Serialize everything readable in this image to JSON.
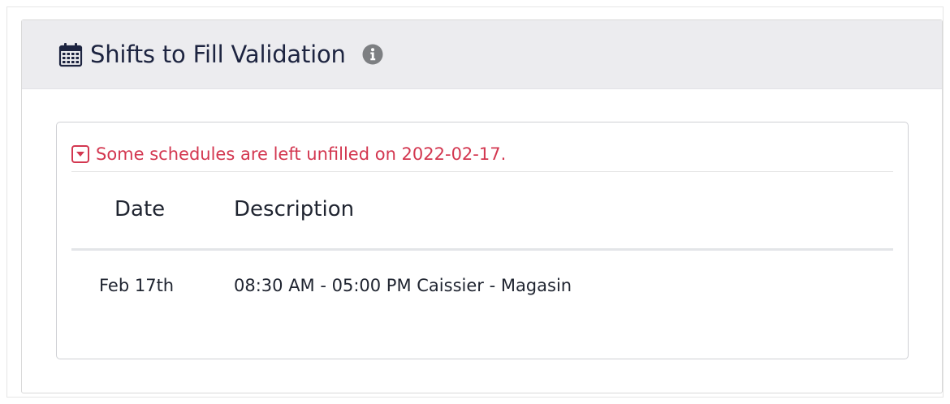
{
  "panel": {
    "title": "Shifts to Fill Validation",
    "title_icon": "calendar-icon",
    "info_icon": "info-icon"
  },
  "alert": {
    "icon": "caret-square-down-icon",
    "message": "Some schedules are left unfilled on 2022-02-17.",
    "color": "#d33750"
  },
  "table": {
    "columns": [
      "Date",
      "Description"
    ],
    "rows": [
      {
        "date": "Feb 17th",
        "description": "08:30 AM - 05:00 PM Caissier - Magasin"
      }
    ]
  }
}
